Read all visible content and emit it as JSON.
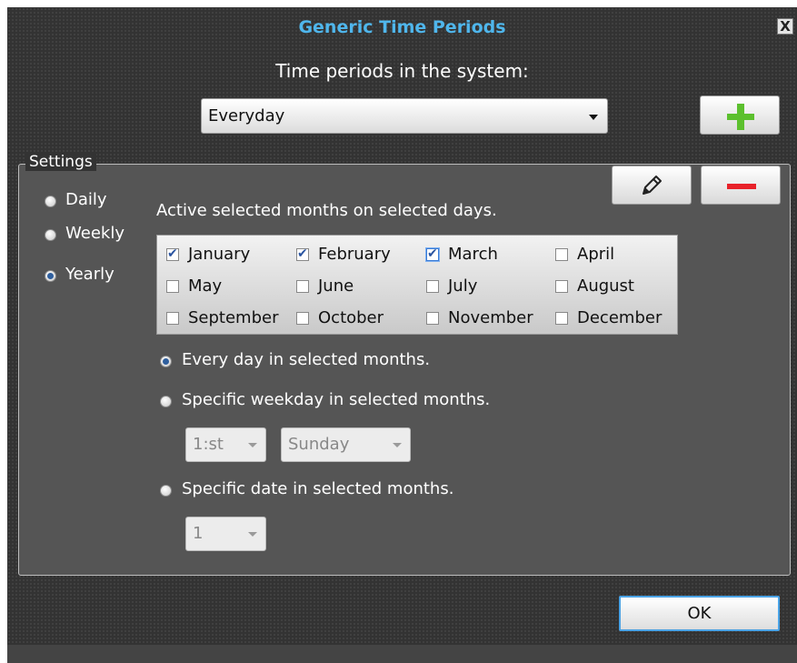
{
  "window": {
    "title": "Generic Time Periods",
    "close_glyph": "X"
  },
  "periods": {
    "prompt": "Time periods in the system:",
    "selected": "Everyday"
  },
  "buttons": {
    "add_icon": "plus-icon",
    "edit_icon": "pencil-icon",
    "remove_icon": "minus-icon",
    "ok_label": "OK"
  },
  "settings": {
    "legend": "Settings",
    "frequency": [
      {
        "label": "Daily",
        "selected": false
      },
      {
        "label": "Weekly",
        "selected": false
      },
      {
        "label": "Yearly",
        "selected": true
      }
    ],
    "header": "Active selected months on selected days.",
    "months": [
      {
        "label": "January",
        "checked": true
      },
      {
        "label": "February",
        "checked": true
      },
      {
        "label": "March",
        "checked": true
      },
      {
        "label": "April",
        "checked": false
      },
      {
        "label": "May",
        "checked": false
      },
      {
        "label": "June",
        "checked": false
      },
      {
        "label": "July",
        "checked": false
      },
      {
        "label": "August",
        "checked": false
      },
      {
        "label": "September",
        "checked": false
      },
      {
        "label": "October",
        "checked": false
      },
      {
        "label": "November",
        "checked": false
      },
      {
        "label": "December",
        "checked": false
      }
    ],
    "options": [
      {
        "label": "Every day in selected months.",
        "selected": true
      },
      {
        "label": "Specific weekday in selected months.",
        "selected": false
      },
      {
        "label": "Specific date in selected months.",
        "selected": false
      }
    ],
    "weekday_ordinal": "1:st",
    "weekday_name": "Sunday",
    "date_value": "1"
  },
  "colors": {
    "title": "#4fb6ec",
    "background": "#333333",
    "panel": "#555555",
    "add": "#5cc02e",
    "remove": "#e8222a",
    "focus": "#4aa3e6"
  }
}
